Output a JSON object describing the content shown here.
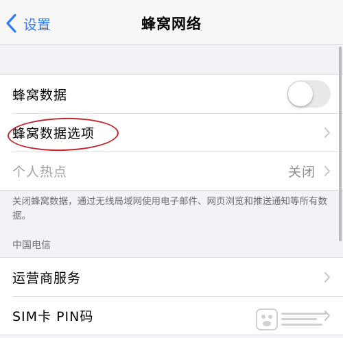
{
  "nav": {
    "back_label": "设置",
    "title": "蜂窝网络"
  },
  "cellular_group": {
    "cellular_data": {
      "label": "蜂窝数据",
      "toggle_on": false
    },
    "cellular_data_options": {
      "label": "蜂窝数据选项"
    },
    "personal_hotspot": {
      "label": "个人热点",
      "value": "关闭"
    }
  },
  "footnote": "关闭蜂窝数据，通过无线局域网使用电子邮件、网页浏览和推送通知等所有数据。",
  "carrier_section": {
    "header": "中国电信",
    "items": [
      {
        "label": "运营商服务"
      },
      {
        "label": "SIM卡 PIN码"
      }
    ]
  },
  "colors": {
    "accent": "#2f7cf6",
    "annotation": "#c0272d",
    "background": "#f2f2f7"
  },
  "icons": {
    "back": "chevron-left-icon",
    "disclosure": "chevron-right-icon"
  }
}
